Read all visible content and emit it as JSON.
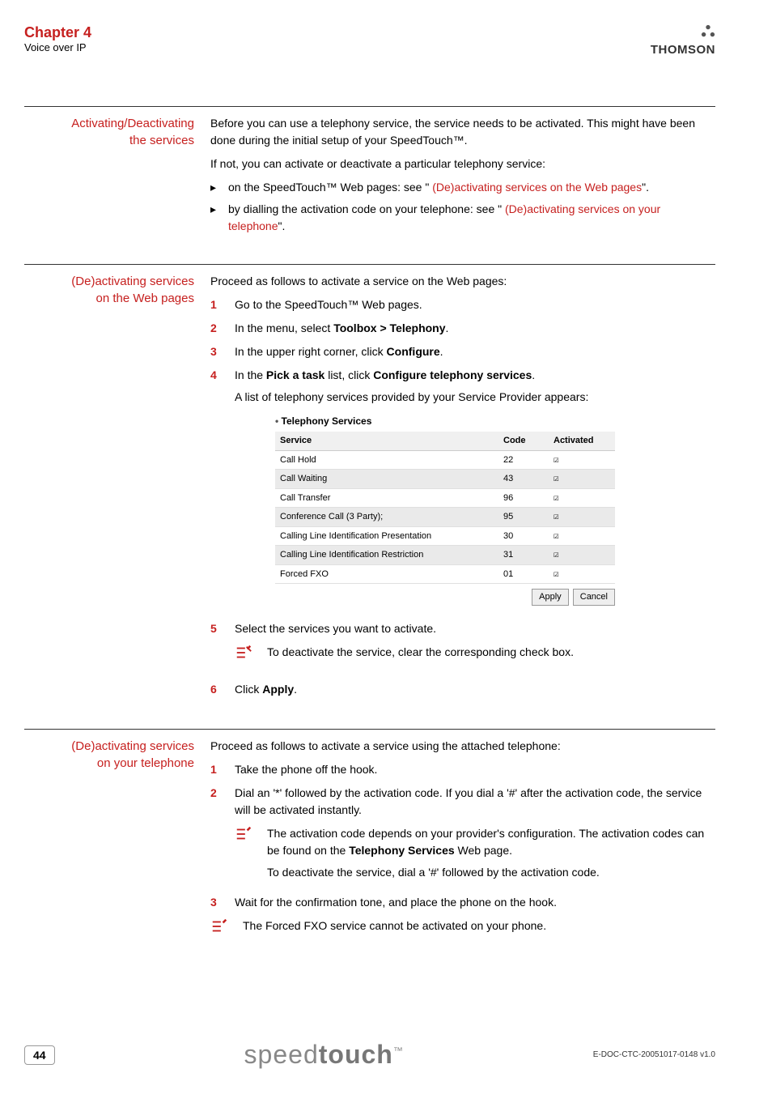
{
  "header": {
    "chapter": "Chapter 4",
    "subchapter": "Voice over IP",
    "logo_text": "THOMSON"
  },
  "section1": {
    "label_l1": "Activating/Deactivating",
    "label_l2": "the services",
    "p1": "Before you can use a telephony service, the service needs to be activated. This might have been done during the initial setup of your SpeedTouch™.",
    "p2": "If not, you can activate or deactivate a particular telephony service:",
    "b1_pre": "on the SpeedTouch™ Web pages: see \" ",
    "b1_link": "(De)activating services on the Web pages",
    "b1_post": "\".",
    "b2_pre": "by dialling the activation code on your telephone: see \" ",
    "b2_link": "(De)activating services on your telephone",
    "b2_post": "\"."
  },
  "section2": {
    "label_l1": "(De)activating services",
    "label_l2": "on the Web pages",
    "intro": "Proceed as follows to activate a service on the Web pages:",
    "s1": "Go to the SpeedTouch™ Web pages.",
    "s2_pre": "In the menu, select ",
    "s2_bold": "Toolbox > Telephony",
    "s2_post": ".",
    "s3_pre": "In the upper right corner, click ",
    "s3_bold": "Configure",
    "s3_post": ".",
    "s4_pre": "In the ",
    "s4_b1": "Pick a task",
    "s4_mid": " list, click ",
    "s4_b2": "Configure telephony services",
    "s4_post": ".",
    "s4_p2": "A list of telephony services provided by your Service Provider appears:",
    "s5": "Select the services you want to activate.",
    "s5_note": "To deactivate the service, clear the corresponding check box.",
    "s6_pre": "Click ",
    "s6_bold": "Apply",
    "s6_post": "."
  },
  "screenshot": {
    "title": "Telephony Services",
    "col_service": "Service",
    "col_code": "Code",
    "col_activated": "Activated",
    "rows": [
      {
        "service": "Call Hold",
        "code": "22",
        "checked": true
      },
      {
        "service": "Call Waiting",
        "code": "43",
        "checked": true
      },
      {
        "service": "Call Transfer",
        "code": "96",
        "checked": true
      },
      {
        "service": "Conference Call (3 Party);",
        "code": "95",
        "checked": true
      },
      {
        "service": "Calling Line Identification Presentation",
        "code": "30",
        "checked": true
      },
      {
        "service": "Calling Line Identification Restriction",
        "code": "31",
        "checked": true
      },
      {
        "service": "Forced FXO",
        "code": "01",
        "checked": true
      }
    ],
    "btn_apply": "Apply",
    "btn_cancel": "Cancel"
  },
  "section3": {
    "label_l1": "(De)activating services",
    "label_l2": "on your telephone",
    "intro": "Proceed as follows to activate a service using the attached telephone:",
    "s1": "Take the phone off the hook.",
    "s2": "Dial an '*' followed by the activation code. If you dial a '#' after the activation code, the service will be activated instantly.",
    "note1_l1_pre": "The activation code depends on your provider's configuration. The activation codes can be found on the ",
    "note1_l1_bold": "Telephony Services",
    "note1_l1_post": " Web page.",
    "note1_l2": "To deactivate the service, dial a '#' followed by the activation code.",
    "s3": "Wait for the confirmation tone, and place the phone on the hook.",
    "note2": "The Forced FXO service cannot be activated on your phone."
  },
  "footer": {
    "page": "44",
    "brand_a": "speed",
    "brand_b": "touch",
    "brand_tm": "™",
    "docid": "E-DOC-CTC-20051017-0148 v1.0"
  },
  "nums": {
    "n1": "1",
    "n2": "2",
    "n3": "3",
    "n4": "4",
    "n5": "5",
    "n6": "6"
  }
}
